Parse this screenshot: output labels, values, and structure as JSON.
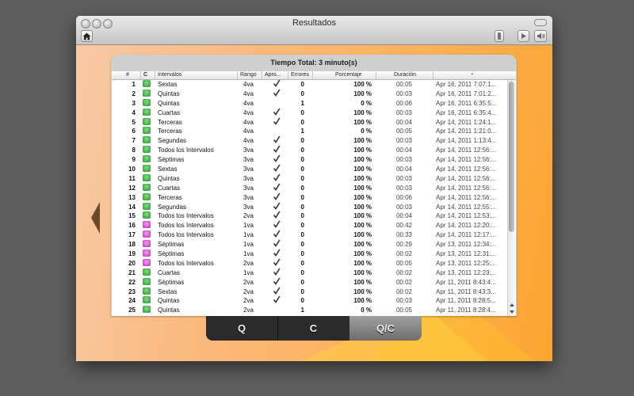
{
  "window": {
    "title": "Resultados"
  },
  "toolbar": {
    "home_icon": "home-icon",
    "info_icon": "info-icon",
    "play_icon": "play-icon",
    "volume_icon": "speaker-icon"
  },
  "panel": {
    "total_label": "Tiempo Total:",
    "total_value": "3 minuto(s)"
  },
  "table": {
    "columns": [
      "#",
      "C",
      "Intervalos",
      "Rango",
      "Apro...",
      "Errores",
      "Porcentaje",
      "Duración",
      "◔"
    ],
    "rows": [
      {
        "num": "1",
        "icon": "g",
        "interval": "Sextas",
        "rango": "4va",
        "approved": true,
        "errors": "0",
        "pct": "100 %",
        "dur": "00:05",
        "date": "Apr 16, 2011 7:07:1..."
      },
      {
        "num": "2",
        "icon": "g",
        "interval": "Quintas",
        "rango": "4va",
        "approved": true,
        "errors": "0",
        "pct": "100 %",
        "dur": "00:03",
        "date": "Apr 16, 2011 7:01:2..."
      },
      {
        "num": "3",
        "icon": "g",
        "interval": "Quintas",
        "rango": "4va",
        "approved": false,
        "errors": "1",
        "pct": "0 %",
        "dur": "00:06",
        "date": "Apr 16, 2011 6:35:5..."
      },
      {
        "num": "4",
        "icon": "g",
        "interval": "Cuartas",
        "rango": "4va",
        "approved": true,
        "errors": "0",
        "pct": "100 %",
        "dur": "00:03",
        "date": "Apr 16, 2011 6:35:4..."
      },
      {
        "num": "5",
        "icon": "g",
        "interval": "Terceras",
        "rango": "4va",
        "approved": true,
        "errors": "0",
        "pct": "100 %",
        "dur": "00:04",
        "date": "Apr 14, 2011 1:24:1..."
      },
      {
        "num": "6",
        "icon": "g",
        "interval": "Terceras",
        "rango": "4va",
        "approved": false,
        "errors": "1",
        "pct": "0 %",
        "dur": "00:05",
        "date": "Apr 14, 2011 1:21:0..."
      },
      {
        "num": "7",
        "icon": "g",
        "interval": "Segundas",
        "rango": "4va",
        "approved": true,
        "errors": "0",
        "pct": "100 %",
        "dur": "00:03",
        "date": "Apr 14, 2011 1:13:4..."
      },
      {
        "num": "8",
        "icon": "g",
        "interval": "Todos los Intervalos",
        "rango": "3va",
        "approved": true,
        "errors": "0",
        "pct": "100 %",
        "dur": "00:04",
        "date": "Apr 14, 2011 12:56:..."
      },
      {
        "num": "9",
        "icon": "g",
        "interval": "Séptimas",
        "rango": "3va",
        "approved": true,
        "errors": "0",
        "pct": "100 %",
        "dur": "00:03",
        "date": "Apr 14, 2011 12:56:..."
      },
      {
        "num": "10",
        "icon": "g",
        "interval": "Sextas",
        "rango": "3va",
        "approved": true,
        "errors": "0",
        "pct": "100 %",
        "dur": "00:04",
        "date": "Apr 14, 2011 12:56:..."
      },
      {
        "num": "11",
        "icon": "g",
        "interval": "Quintas",
        "rango": "3va",
        "approved": true,
        "errors": "0",
        "pct": "100 %",
        "dur": "00:03",
        "date": "Apr 14, 2011 12:56:..."
      },
      {
        "num": "12",
        "icon": "g",
        "interval": "Cuartas",
        "rango": "3va",
        "approved": true,
        "errors": "0",
        "pct": "100 %",
        "dur": "00:03",
        "date": "Apr 14, 2011 12:56:..."
      },
      {
        "num": "13",
        "icon": "g",
        "interval": "Terceras",
        "rango": "3va",
        "approved": true,
        "errors": "0",
        "pct": "100 %",
        "dur": "00:06",
        "date": "Apr 14, 2011 12:56:..."
      },
      {
        "num": "14",
        "icon": "g",
        "interval": "Segundas",
        "rango": "3va",
        "approved": true,
        "errors": "0",
        "pct": "100 %",
        "dur": "00:03",
        "date": "Apr 14, 2011 12:55:..."
      },
      {
        "num": "15",
        "icon": "g",
        "interval": "Todos los Intervalos",
        "rango": "2va",
        "approved": true,
        "errors": "0",
        "pct": "100 %",
        "dur": "00:04",
        "date": "Apr 14, 2011 12:53:..."
      },
      {
        "num": "16",
        "icon": "p",
        "interval": "Todos los Intervalos",
        "rango": "1va",
        "approved": true,
        "errors": "0",
        "pct": "100 %",
        "dur": "00:42",
        "date": "Apr 14, 2011 12:20:..."
      },
      {
        "num": "17",
        "icon": "p",
        "interval": "Todos los Intervalos",
        "rango": "1va",
        "approved": true,
        "errors": "0",
        "pct": "100 %",
        "dur": "00:33",
        "date": "Apr 14, 2011 12:17:..."
      },
      {
        "num": "18",
        "icon": "p",
        "interval": "Séptimas",
        "rango": "1va",
        "approved": true,
        "errors": "0",
        "pct": "100 %",
        "dur": "00:29",
        "date": "Apr 13, 2011 12:34:..."
      },
      {
        "num": "19",
        "icon": "p",
        "interval": "Séptimas",
        "rango": "1va",
        "approved": true,
        "errors": "0",
        "pct": "100 %",
        "dur": "00:02",
        "date": "Apr 13, 2011 12:31:..."
      },
      {
        "num": "20",
        "icon": "p",
        "interval": "Todos los Intervalos",
        "rango": "2va",
        "approved": true,
        "errors": "0",
        "pct": "100 %",
        "dur": "00:05",
        "date": "Apr 13, 2011 12:25:..."
      },
      {
        "num": "21",
        "icon": "g",
        "interval": "Cuartas",
        "rango": "1va",
        "approved": true,
        "errors": "0",
        "pct": "100 %",
        "dur": "00:02",
        "date": "Apr 13, 2011 12:23:..."
      },
      {
        "num": "22",
        "icon": "g",
        "interval": "Séptimas",
        "rango": "2va",
        "approved": true,
        "errors": "0",
        "pct": "100 %",
        "dur": "00:02",
        "date": "Apr 11, 2011 8:43:4..."
      },
      {
        "num": "23",
        "icon": "g",
        "interval": "Sextas",
        "rango": "2va",
        "approved": true,
        "errors": "0",
        "pct": "100 %",
        "dur": "00:02",
        "date": "Apr 11, 2011 8:43:3..."
      },
      {
        "num": "24",
        "icon": "g",
        "interval": "Quintas",
        "rango": "2va",
        "approved": true,
        "errors": "0",
        "pct": "100 %",
        "dur": "00:03",
        "date": "Apr 11, 2011 8:28:5..."
      },
      {
        "num": "25",
        "icon": "g",
        "interval": "Quintas",
        "rango": "2va",
        "approved": false,
        "errors": "1",
        "pct": "0 %",
        "dur": "00:05",
        "date": "Apr 11, 2011 8:28:4..."
      }
    ]
  },
  "segments": [
    {
      "label": "Q",
      "active": false
    },
    {
      "label": "C",
      "active": false
    },
    {
      "label": "Q/C",
      "active": true
    }
  ],
  "colors": {
    "accent": "#fca42f",
    "background": "#5f5f5f",
    "check": "#333333"
  }
}
